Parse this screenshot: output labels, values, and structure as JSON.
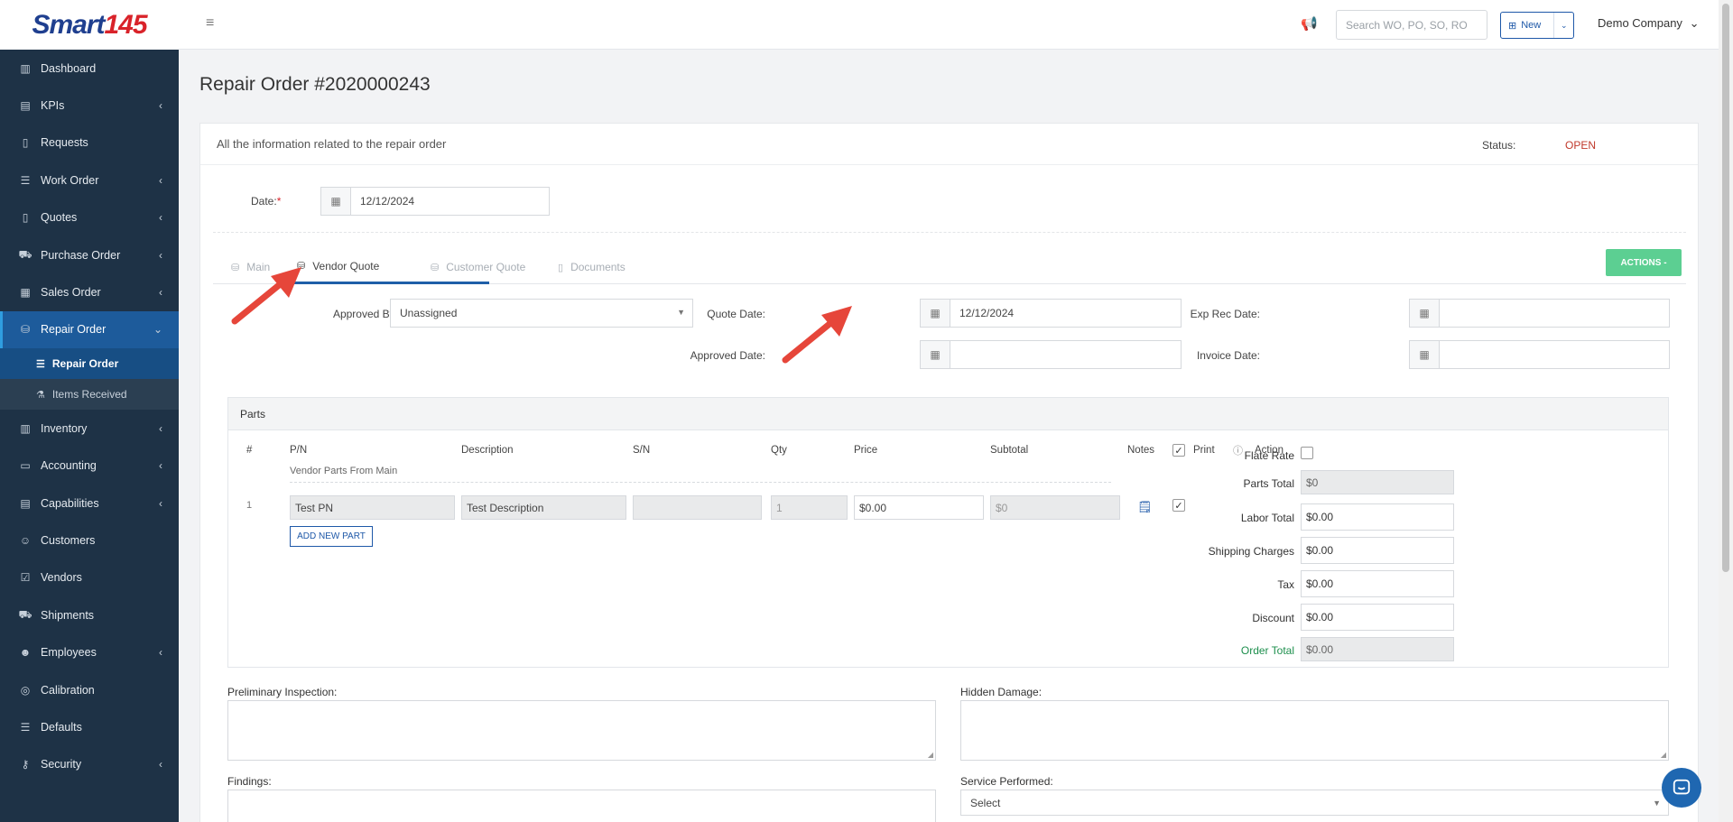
{
  "app": {
    "logo_text": "Smart",
    "logo_num": "145"
  },
  "sidebar": {
    "items": [
      {
        "label": "Dashboard",
        "icon": "chart-icon",
        "chevron": false
      },
      {
        "label": "KPIs",
        "icon": "kpi-icon",
        "chevron": true
      },
      {
        "label": "Requests",
        "icon": "file-icon",
        "chevron": false
      },
      {
        "label": "Work Order",
        "icon": "list-icon",
        "chevron": true
      },
      {
        "label": "Quotes",
        "icon": "doc-icon",
        "chevron": true
      },
      {
        "label": "Purchase Order",
        "icon": "cart-icon",
        "chevron": true
      },
      {
        "label": "Sales Order",
        "icon": "register-icon",
        "chevron": true
      },
      {
        "label": "Repair Order",
        "icon": "repair-icon",
        "chevron": true
      },
      {
        "label": "Repair Order",
        "sub": true
      },
      {
        "label": "Items Received",
        "sub": true
      },
      {
        "label": "Inventory",
        "icon": "inventory-icon",
        "chevron": true
      },
      {
        "label": "Accounting",
        "icon": "accounting-icon",
        "chevron": true
      },
      {
        "label": "Capabilities",
        "icon": "capabilities-icon",
        "chevron": true
      },
      {
        "label": "Customers",
        "icon": "customers-icon",
        "chevron": false
      },
      {
        "label": "Vendors",
        "icon": "vendors-icon",
        "chevron": false
      },
      {
        "label": "Shipments",
        "icon": "truck-icon",
        "chevron": false
      },
      {
        "label": "Employees",
        "icon": "employees-icon",
        "chevron": true
      },
      {
        "label": "Calibration",
        "icon": "calibration-icon",
        "chevron": false
      },
      {
        "label": "Defaults",
        "icon": "defaults-icon",
        "chevron": false
      },
      {
        "label": "Security",
        "icon": "key-icon",
        "chevron": true
      }
    ]
  },
  "topbar": {
    "search_placeholder": "Search WO, PO, SO, RO",
    "new_label": "New",
    "company": "Demo Company"
  },
  "page": {
    "title": "Repair Order #2020000243",
    "subtitle": "All the information related to the repair order",
    "status_label": "Status:",
    "status_value": "OPEN",
    "status_color": "#c0392b",
    "date_label": "Date:",
    "date_required": "*",
    "date_value": "12/12/2024"
  },
  "tabs": [
    {
      "label": "Main",
      "active": false
    },
    {
      "label": "Vendor Quote",
      "active": true
    },
    {
      "label": "Customer Quote",
      "active": false
    },
    {
      "label": "Documents",
      "active": false
    }
  ],
  "actions_label": "ACTIONS -",
  "vendor_quote": {
    "approved_by_label": "Approved By:",
    "approved_by_value": "Unassigned",
    "quote_date_label": "Quote Date:",
    "quote_date_value": "12/12/2024",
    "approved_date_label": "Approved Date:",
    "approved_date_value": "",
    "exp_rec_date_label": "Exp Rec Date:",
    "exp_rec_date_value": "",
    "invoice_date_label": "Invoice Date:",
    "invoice_date_value": ""
  },
  "parts": {
    "title": "Parts",
    "headers": [
      "#",
      "P/N",
      "Description",
      "S/N",
      "Qty",
      "Price",
      "Subtotal",
      "Notes",
      "Print",
      "Action"
    ],
    "vendor_parts_label": "Vendor Parts From Main",
    "rows": [
      {
        "num": "1",
        "pn": "Test PN",
        "description": "Test Description",
        "sn": "",
        "qty": "1",
        "price": "$0.00",
        "subtotal": "$0"
      }
    ],
    "add_new_part": "ADD NEW PART"
  },
  "totals": {
    "flat_rate_label": "Flate Rate",
    "parts_total_label": "Parts Total",
    "parts_total_value": "$0",
    "labor_total_label": "Labor Total",
    "labor_total_value": "$0.00",
    "shipping_label": "Shipping Charges",
    "shipping_value": "$0.00",
    "tax_label": "Tax",
    "tax_value": "$0.00",
    "discount_label": "Discount",
    "discount_value": "$0.00",
    "order_total_label": "Order Total",
    "order_total_value": "$0.00"
  },
  "notes": {
    "preliminary_label": "Preliminary Inspection:",
    "hidden_damage_label": "Hidden Damage:",
    "findings_label": "Findings:",
    "service_performed_label": "Service Performed:",
    "service_performed_value": "Select"
  },
  "colors": {
    "sidebar_bg": "#1e3246",
    "active_blue": "#1d5b9b",
    "actions_green": "#5ccf92",
    "brand_blue": "#1e58a8"
  }
}
